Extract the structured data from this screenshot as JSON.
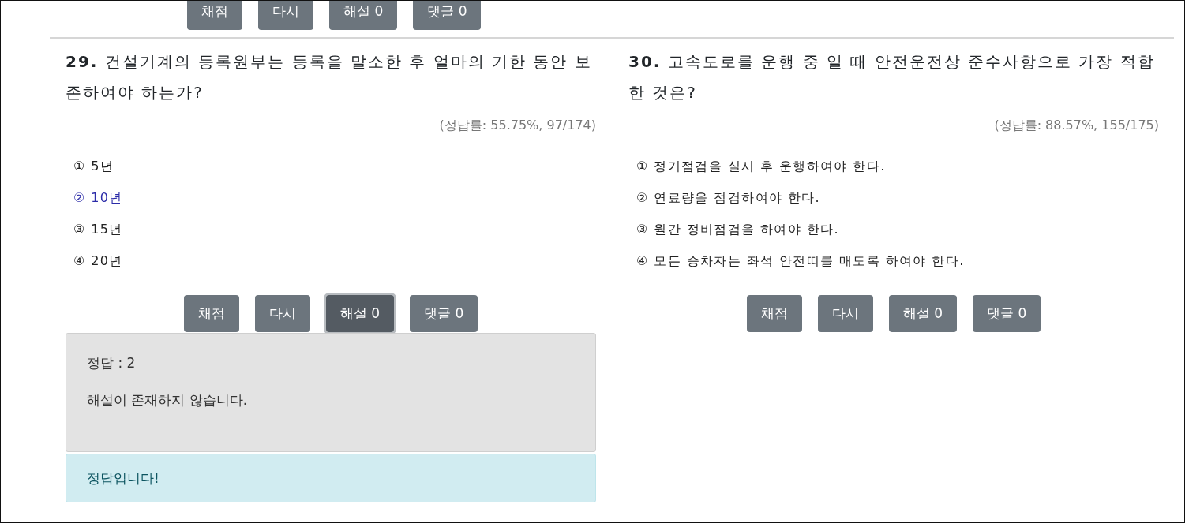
{
  "top_buttons": [
    {
      "label": "채점",
      "pressed": false
    },
    {
      "label": "다시",
      "pressed": false
    },
    {
      "label": "해설 0",
      "pressed": false
    },
    {
      "label": "댓글 0",
      "pressed": false
    }
  ],
  "questions": [
    {
      "title": "**29.** 건설기계의 등록원부는 등록을 말소한 후 얼마의 기한 동안 보존하여야 하는가?",
      "rate": "(정답률: 55.75%, 97/174)",
      "options": [
        {
          "text": "① 5년",
          "selected": false
        },
        {
          "text": "② 10년",
          "selected": true
        },
        {
          "text": "③ 15년",
          "selected": false
        },
        {
          "text": "④ 20년",
          "selected": false
        }
      ],
      "buttons": [
        {
          "label": "채점",
          "pressed": false
        },
        {
          "label": "다시",
          "pressed": false
        },
        {
          "label": "해설 0",
          "pressed": true
        },
        {
          "label": "댓글 0",
          "pressed": false
        }
      ],
      "explanation": {
        "answer": "정답 : 2",
        "text": "해설이 존재하지 않습니다."
      },
      "result": "정답입니다!"
    },
    {
      "title": "**30.** 고속도로를 운행 중 일 때 안전운전상 준수사항으로 가장 적합한 것은?",
      "rate": "(정답률: 88.57%, 155/175)",
      "options": [
        {
          "text": "① 정기점검을 실시 후 운행하여야 한다.",
          "selected": false
        },
        {
          "text": "② 연료량을 점검하여야 한다.",
          "selected": false
        },
        {
          "text": "③ 월간 정비점검을 하여야 한다.",
          "selected": false
        },
        {
          "text": "④ 모든 승차자는 좌석 안전띠를 매도록 하여야 한다.",
          "selected": false
        }
      ],
      "buttons": [
        {
          "label": "채점",
          "pressed": false
        },
        {
          "label": "다시",
          "pressed": false
        },
        {
          "label": "해설 0",
          "pressed": false
        },
        {
          "label": "댓글 0",
          "pressed": false
        }
      ]
    }
  ]
}
